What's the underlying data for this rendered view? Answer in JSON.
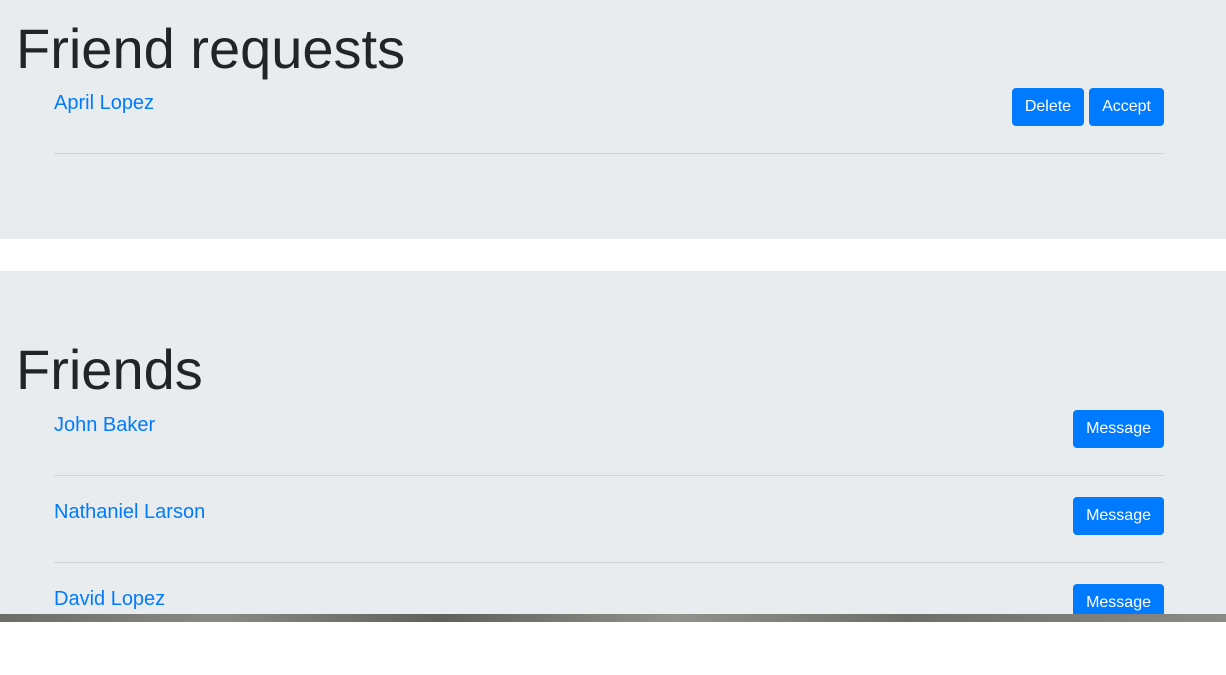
{
  "friend_requests": {
    "title": "Friend requests",
    "items": [
      {
        "name": "April Lopez",
        "delete_label": "Delete",
        "accept_label": "Accept"
      }
    ]
  },
  "friends": {
    "title": "Friends",
    "items": [
      {
        "name": "John Baker",
        "message_label": "Message"
      },
      {
        "name": "Nathaniel Larson",
        "message_label": "Message"
      },
      {
        "name": "David Lopez",
        "message_label": "Message"
      }
    ]
  },
  "colors": {
    "panel_background": "#e9ecef",
    "link": "#007bff",
    "button": "#007bff",
    "heading": "#212529"
  }
}
